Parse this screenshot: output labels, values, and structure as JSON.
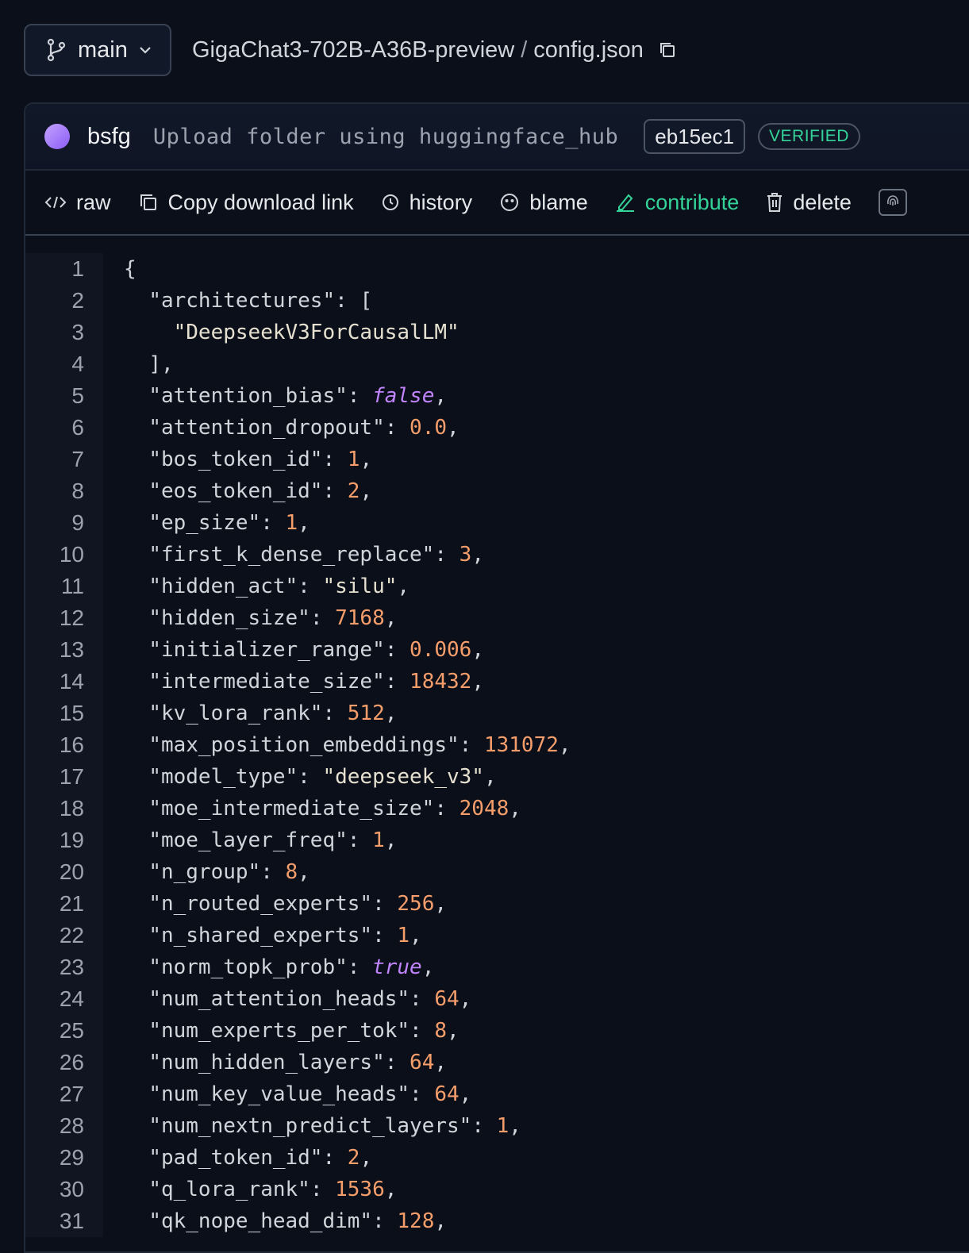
{
  "header": {
    "branch": "main",
    "repo": "GigaChat3-702B-A36B-preview",
    "separator": "/",
    "file": "config.json"
  },
  "commit": {
    "author": "bsfg",
    "message": "Upload folder using huggingface_hub",
    "hash": "eb15ec1",
    "badge": "VERIFIED"
  },
  "actions": {
    "raw": "raw",
    "copy": "Copy download link",
    "history": "history",
    "blame": "blame",
    "contribute": "contribute",
    "delete": "delete"
  },
  "colors": {
    "accent_green": "#34d399",
    "number": "#f59e6b",
    "boolean": "#c084fc"
  },
  "code": {
    "lines": [
      {
        "n": "1",
        "indent": "",
        "key": "",
        "val": "{",
        "type": "p",
        "tail": ""
      },
      {
        "n": "2",
        "indent": "  ",
        "key": "\"architectures\"",
        "val": "[",
        "type": "p",
        "tail": ""
      },
      {
        "n": "3",
        "indent": "    ",
        "key": "",
        "val": "\"DeepseekV3ForCausalLM\"",
        "type": "s",
        "tail": ""
      },
      {
        "n": "4",
        "indent": "  ",
        "key": "",
        "val": "],",
        "type": "p",
        "tail": ""
      },
      {
        "n": "5",
        "indent": "  ",
        "key": "\"attention_bias\"",
        "val": "false",
        "type": "b",
        "tail": ","
      },
      {
        "n": "6",
        "indent": "  ",
        "key": "\"attention_dropout\"",
        "val": "0.0",
        "type": "n",
        "tail": ","
      },
      {
        "n": "7",
        "indent": "  ",
        "key": "\"bos_token_id\"",
        "val": "1",
        "type": "n",
        "tail": ","
      },
      {
        "n": "8",
        "indent": "  ",
        "key": "\"eos_token_id\"",
        "val": "2",
        "type": "n",
        "tail": ","
      },
      {
        "n": "9",
        "indent": "  ",
        "key": "\"ep_size\"",
        "val": "1",
        "type": "n",
        "tail": ","
      },
      {
        "n": "10",
        "indent": "  ",
        "key": "\"first_k_dense_replace\"",
        "val": "3",
        "type": "n",
        "tail": ","
      },
      {
        "n": "11",
        "indent": "  ",
        "key": "\"hidden_act\"",
        "val": "\"silu\"",
        "type": "s",
        "tail": ","
      },
      {
        "n": "12",
        "indent": "  ",
        "key": "\"hidden_size\"",
        "val": "7168",
        "type": "n",
        "tail": ","
      },
      {
        "n": "13",
        "indent": "  ",
        "key": "\"initializer_range\"",
        "val": "0.006",
        "type": "n",
        "tail": ","
      },
      {
        "n": "14",
        "indent": "  ",
        "key": "\"intermediate_size\"",
        "val": "18432",
        "type": "n",
        "tail": ","
      },
      {
        "n": "15",
        "indent": "  ",
        "key": "\"kv_lora_rank\"",
        "val": "512",
        "type": "n",
        "tail": ","
      },
      {
        "n": "16",
        "indent": "  ",
        "key": "\"max_position_embeddings\"",
        "val": "131072",
        "type": "n",
        "tail": ","
      },
      {
        "n": "17",
        "indent": "  ",
        "key": "\"model_type\"",
        "val": "\"deepseek_v3\"",
        "type": "s",
        "tail": ","
      },
      {
        "n": "18",
        "indent": "  ",
        "key": "\"moe_intermediate_size\"",
        "val": "2048",
        "type": "n",
        "tail": ","
      },
      {
        "n": "19",
        "indent": "  ",
        "key": "\"moe_layer_freq\"",
        "val": "1",
        "type": "n",
        "tail": ","
      },
      {
        "n": "20",
        "indent": "  ",
        "key": "\"n_group\"",
        "val": "8",
        "type": "n",
        "tail": ","
      },
      {
        "n": "21",
        "indent": "  ",
        "key": "\"n_routed_experts\"",
        "val": "256",
        "type": "n",
        "tail": ","
      },
      {
        "n": "22",
        "indent": "  ",
        "key": "\"n_shared_experts\"",
        "val": "1",
        "type": "n",
        "tail": ","
      },
      {
        "n": "23",
        "indent": "  ",
        "key": "\"norm_topk_prob\"",
        "val": "true",
        "type": "b",
        "tail": ","
      },
      {
        "n": "24",
        "indent": "  ",
        "key": "\"num_attention_heads\"",
        "val": "64",
        "type": "n",
        "tail": ","
      },
      {
        "n": "25",
        "indent": "  ",
        "key": "\"num_experts_per_tok\"",
        "val": "8",
        "type": "n",
        "tail": ","
      },
      {
        "n": "26",
        "indent": "  ",
        "key": "\"num_hidden_layers\"",
        "val": "64",
        "type": "n",
        "tail": ","
      },
      {
        "n": "27",
        "indent": "  ",
        "key": "\"num_key_value_heads\"",
        "val": "64",
        "type": "n",
        "tail": ","
      },
      {
        "n": "28",
        "indent": "  ",
        "key": "\"num_nextn_predict_layers\"",
        "val": "1",
        "type": "n",
        "tail": ","
      },
      {
        "n": "29",
        "indent": "  ",
        "key": "\"pad_token_id\"",
        "val": "2",
        "type": "n",
        "tail": ","
      },
      {
        "n": "30",
        "indent": "  ",
        "key": "\"q_lora_rank\"",
        "val": "1536",
        "type": "n",
        "tail": ","
      },
      {
        "n": "31",
        "indent": "  ",
        "key": "\"qk_nope_head_dim\"",
        "val": "128",
        "type": "n",
        "tail": ","
      }
    ]
  }
}
